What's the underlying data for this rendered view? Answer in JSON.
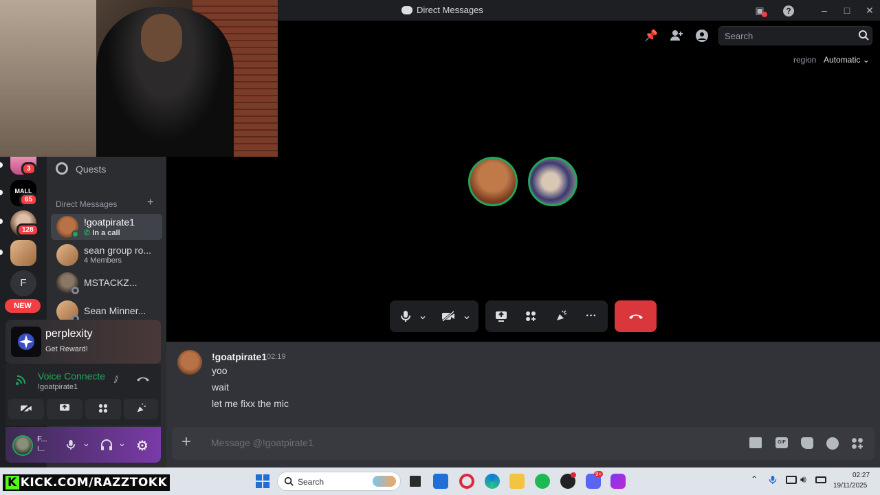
{
  "window": {
    "title": "Direct Messages"
  },
  "header": {
    "search_placeholder": "Search",
    "region_label": "region",
    "region_value": "Automatic"
  },
  "servers": [
    {
      "badge": "3"
    },
    {
      "label": "MALL",
      "badge": "65"
    },
    {
      "badge": "128"
    },
    {
      "badge": ""
    },
    {
      "label": "F"
    },
    {
      "label": "NEW"
    }
  ],
  "sidebar": {
    "quests_label": "Quests",
    "dm_header": "Direct Messages",
    "dms": [
      {
        "name": "!goatpirate1",
        "sub": "In a call"
      },
      {
        "name": "sean group ro...",
        "sub": "4 Members"
      },
      {
        "name": "MSTACKZ...",
        "sub": ""
      },
      {
        "name": "Sean Minner...",
        "sub": ""
      }
    ]
  },
  "promo": {
    "title": "perplexity",
    "sub": "Get Reward!"
  },
  "voice": {
    "status": "Voice Connecte",
    "channel": "!goatpirate1"
  },
  "user_panel": {
    "name": "F...",
    "status": "I..."
  },
  "chat": {
    "author": "!goatpirate1",
    "time": "02:19",
    "messages": [
      "yoo",
      "wait",
      "let me fixx the mic"
    ],
    "input_placeholder": "Message @!goatpirate1"
  },
  "overlay": {
    "watermark": "KICK.COM/RAZZTOKK"
  },
  "taskbar": {
    "search_label": "Search",
    "time": "02:27",
    "date": "19/11/2025",
    "discord_badge": "9+"
  },
  "colors": {
    "accent_green": "#23a55a",
    "hangup_red": "#da373c",
    "badge_red": "#f23f43"
  }
}
